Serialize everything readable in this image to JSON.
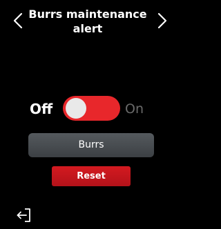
{
  "header": {
    "title_line1": "Burrs maintenance",
    "title_line2": "alert",
    "prev_icon": "chevron-left-icon",
    "next_icon": "chevron-right-icon"
  },
  "toggle": {
    "off_label": "Off",
    "on_label": "On",
    "state": "off",
    "track_color": "#e8272b"
  },
  "buttons": {
    "burrs_label": "Burrs",
    "reset_label": "Reset",
    "reset_color": "#d41a20"
  },
  "footer": {
    "exit_icon": "exit-icon"
  }
}
